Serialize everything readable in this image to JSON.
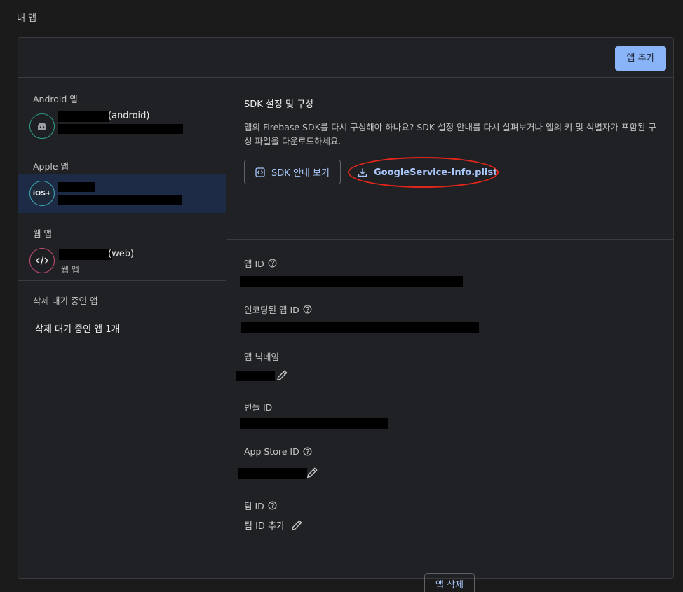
{
  "page": {
    "title": "내 앱"
  },
  "header": {
    "add_app_label": "앱 추가"
  },
  "sidebar": {
    "android_label": "Android 앱",
    "android_app": {
      "suffix": "(android)"
    },
    "apple_label": "Apple 앱",
    "ios_badge": "iOS+",
    "web_label": "웹 앱",
    "web_app": {
      "suffix": "(web)",
      "sub": "웹 앱"
    },
    "pending_label": "삭제 대기 중인 앱",
    "pending_link": "삭제 대기 중인 앱 1개"
  },
  "sdk": {
    "title": "SDK 설정 및 구성",
    "description": "앱의 Firebase SDK를 다시 구성해야 하나요? SDK 설정 안내를 다시 살펴보거나 앱의 키 및 식별자가 포함된 구성 파일을 다운로드하세요.",
    "guide_button": "SDK 안내 보기",
    "download_link": "GoogleService-Info.plist"
  },
  "fields": {
    "app_id_label": "앱 ID",
    "encoded_app_id_label": "인코딩된 앱 ID",
    "nickname_label": "앱 닉네임",
    "bundle_id_label": "번들 ID",
    "app_store_id_label": "App Store ID",
    "team_id_label": "팀 ID",
    "team_id_add": "팀 ID 추가"
  },
  "footer": {
    "delete_app_label": "앱 삭제"
  },
  "colors": {
    "accent": "#8ab4f8",
    "link": "#a8c7fa",
    "selected_bg": "#1d2b47",
    "highlight": "#e3261b"
  }
}
